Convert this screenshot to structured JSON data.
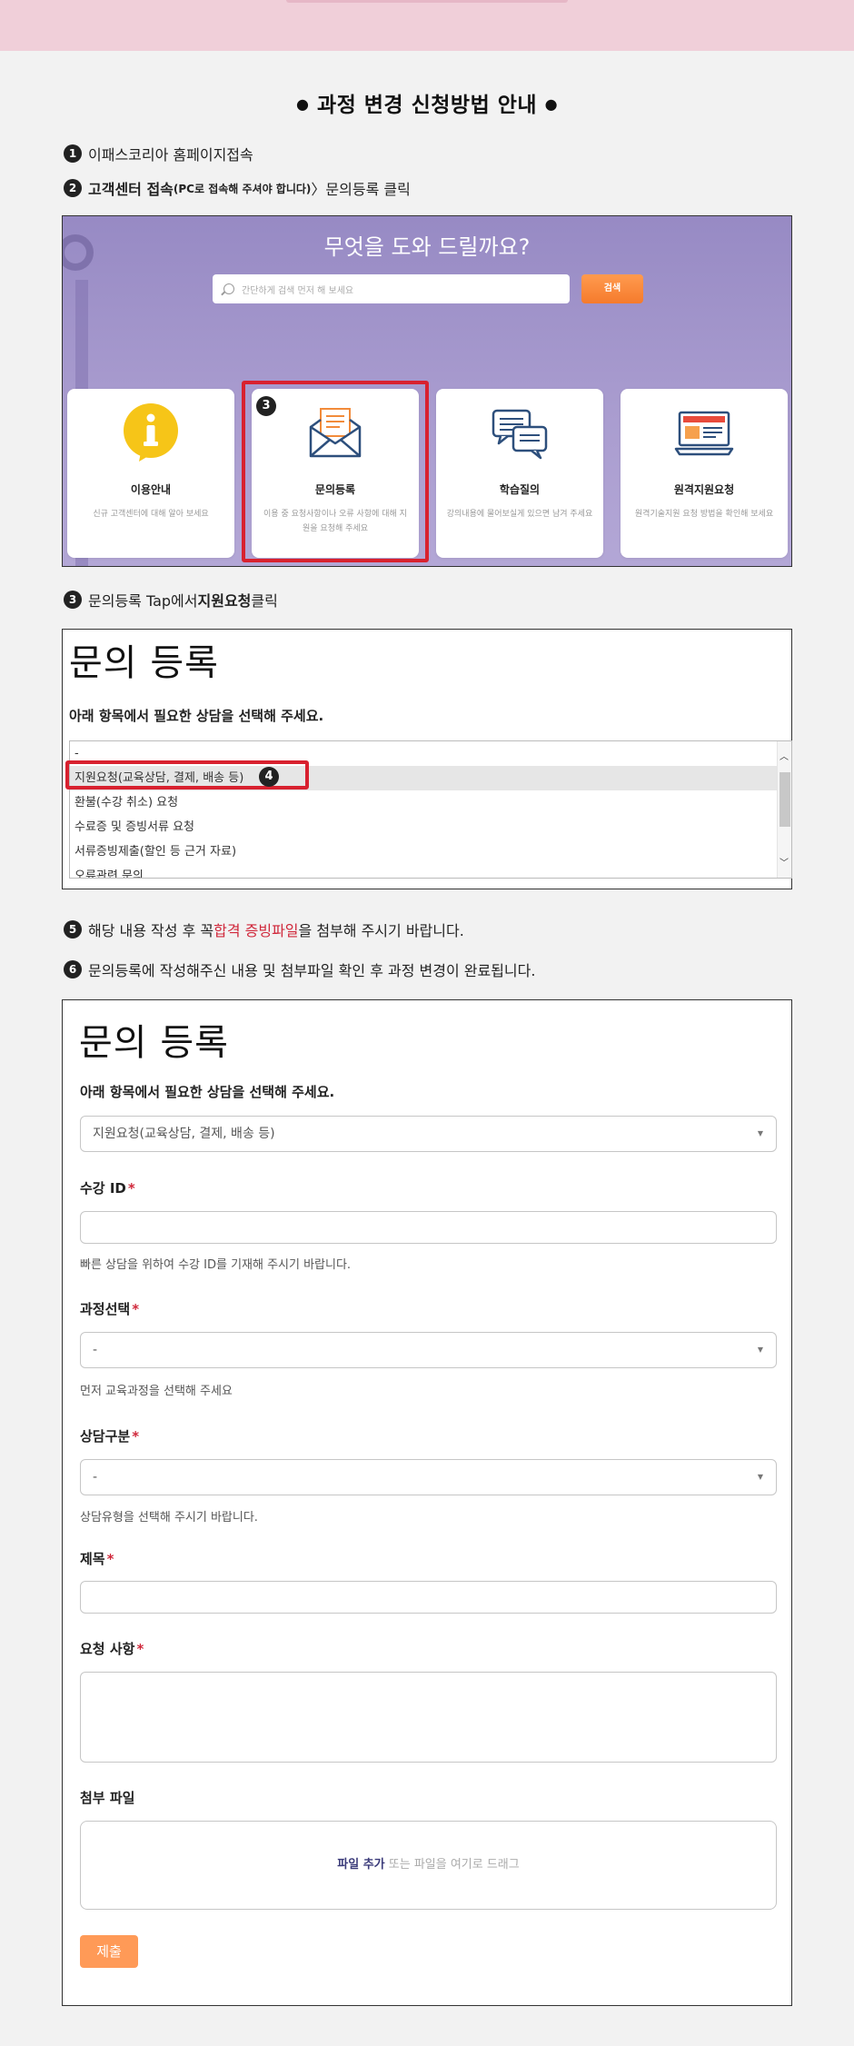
{
  "guide": {
    "title": "과정 변경 신청방법 안내",
    "title_dot": "●",
    "steps": {
      "s1": {
        "num": "1",
        "text": "이패스코리아 홈페이지접속"
      },
      "s2": {
        "num": "2",
        "text_a": "고객센터 접속",
        "text_b": "(PC로 접속해 주셔야 합니다)",
        "text_c": " 〉문의등록 클릭"
      },
      "s3": {
        "num": "3",
        "text_a": "문의등록 Tap에서 ",
        "text_b": "지원요청",
        "text_c": " 클릭"
      },
      "s5": {
        "num": "5",
        "text_a": "해당 내용 작성 후 꼭 ",
        "text_b": "합격 증빙파일",
        "text_c": "을 첨부해 주시기 바랍니다."
      },
      "s6": {
        "num": "6",
        "text": "문의등록에 작성해주신 내용 및 첨부파일 확인 후 과정 변경이 완료됩니다."
      }
    }
  },
  "help_center": {
    "title": "무엇을 도와 드릴까요?",
    "search_placeholder": "간단하게 검색 먼저 해 보세요",
    "search_button": "검색",
    "badge": "3",
    "cards": [
      {
        "label": "이용안내",
        "desc": "신규 고객센터에 대해 알아 보세요",
        "icon": "info-icon"
      },
      {
        "label": "문의등록",
        "desc": "이용 중 요청사항이나 오류 사항에 대해 지원을 요청해 주세요",
        "icon": "envelope-icon"
      },
      {
        "label": "학습질의",
        "desc": "강의내용에 물어보실게 있으면 남겨 주세요",
        "icon": "chat-bubbles-icon"
      },
      {
        "label": "원격지원요청",
        "desc": "원격기술지원 요청 방법을 확인해 보세요",
        "icon": "monitor-icon"
      }
    ]
  },
  "inquiry_list": {
    "title": "문의 등록",
    "subtitle": "아래 항목에서 필요한 상담을 선택해 주세요.",
    "badge": "4",
    "options": [
      "-",
      "지원요청(교육상담, 결제, 배송 등)",
      "환불(수강 취소) 요청",
      "수료증 및 증빙서류 요청",
      "서류증빙제출(할인 등 근거 자료)",
      "오류관련 문의"
    ],
    "selected_index": 1
  },
  "inquiry_form": {
    "title": "문의 등록",
    "subtitle": "아래 항목에서 필요한 상담을 선택해 주세요.",
    "category_value": "지원요청(교육상담, 결제, 배송 등)",
    "student_id": {
      "label": "수강 ID",
      "required": "*",
      "help": "빠른 상담을 위하여 수강 ID를 기재해 주시기 바랍니다.",
      "value": ""
    },
    "course": {
      "label": "과정선택",
      "required": "*",
      "value": "-",
      "help": "먼저 교육과정을 선택해 주세요"
    },
    "consult_type": {
      "label": "상담구분",
      "required": "*",
      "value": "-",
      "help": "상담유형을 선택해 주시기 바랍니다."
    },
    "subject": {
      "label": "제목",
      "required": "*",
      "value": ""
    },
    "request": {
      "label": "요청 사항",
      "required": "*",
      "value": ""
    },
    "attachment": {
      "label": "첨부 파일",
      "add_text": "파일 추가",
      "rest_text": " 또는 파일을 여기로 드래그"
    },
    "submit_label": "제출",
    "caret": "▼"
  },
  "colors": {
    "accent_orange": "#f57b2c",
    "highlight_red": "#d8212f",
    "hero_purple": "#a597cc",
    "top_pink": "#f0cfd9"
  }
}
